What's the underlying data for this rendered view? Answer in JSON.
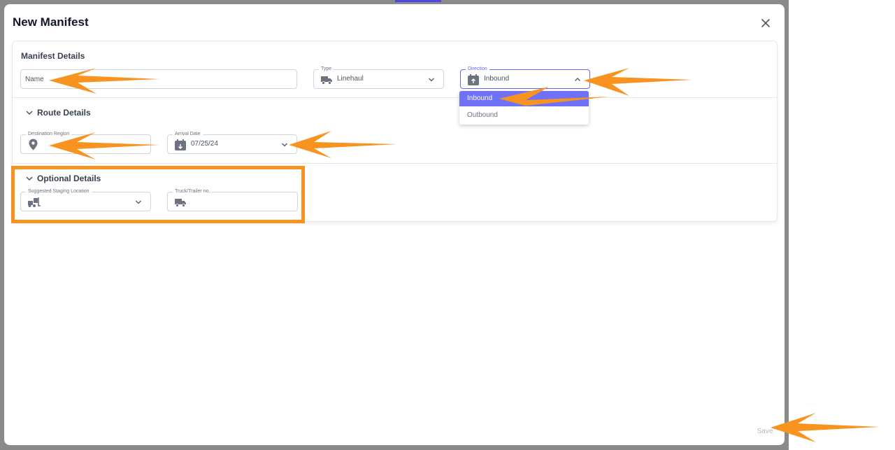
{
  "modal": {
    "title": "New Manifest",
    "save_label": "Save"
  },
  "manifest_details": {
    "title": "Manifest Details",
    "name_placeholder": "Name",
    "type": {
      "label": "Type",
      "value": "Linehaul"
    },
    "direction": {
      "label": "Direction",
      "value": "Inbound",
      "options": [
        {
          "label": "Inbound",
          "selected": true
        },
        {
          "label": "Outbound",
          "selected": false
        }
      ]
    }
  },
  "route_details": {
    "title": "Route Details",
    "destination_label": "Destination Region",
    "arrival_label": "Arrival Date",
    "arrival_value": "07/25/24"
  },
  "optional_details": {
    "title": "Optional Details",
    "staging_label": "Suggested Staging Location",
    "truck_label": "Truck/Trailer no."
  },
  "colors": {
    "accent": "#6366f1",
    "selected_option": "#6f72f6",
    "annotation": "#f7931e"
  },
  "icons": [
    "close-icon",
    "truck-icon",
    "calendar-upload-icon",
    "chevron-down-icon",
    "chevron-up-icon",
    "location-pin-icon",
    "calendar-download-icon",
    "forklift-icon"
  ]
}
